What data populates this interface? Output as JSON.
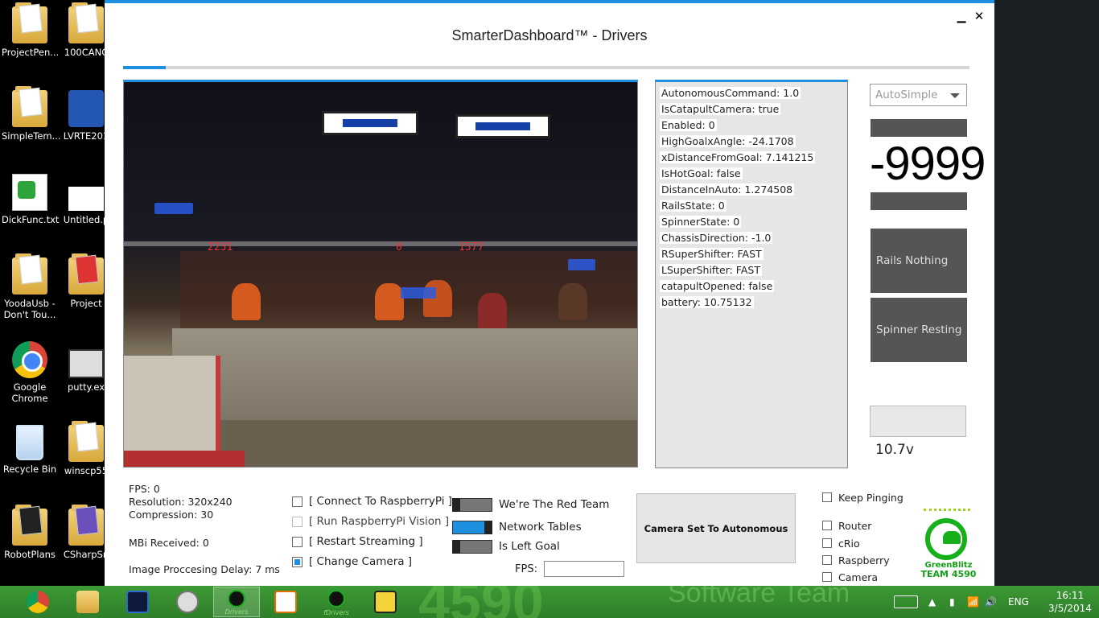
{
  "desktop": {
    "icons": [
      {
        "label": "ProjectPen..."
      },
      {
        "label": "100CANC"
      },
      {
        "label": "SimpleTem..."
      },
      {
        "label": "LVRTE201"
      },
      {
        "label": "DickFunc.txt"
      },
      {
        "label": "Untitled.p"
      },
      {
        "label": "YoodaUsb - Don't Tou..."
      },
      {
        "label": "Project"
      },
      {
        "label": "Google Chrome"
      },
      {
        "label": "putty.ex"
      },
      {
        "label": "Recycle Bin"
      },
      {
        "label": "winscp55"
      },
      {
        "label": "RobotPlans"
      },
      {
        "label": "CSharpSn"
      }
    ]
  },
  "window": {
    "title": "SmarterDashboard™ - Drivers",
    "minimize_glyph": "▁",
    "close_glyph": "✕",
    "progress_fraction": 0.05
  },
  "camera": {
    "scoreboard": [
      "2231",
      "0",
      "1577"
    ]
  },
  "network_values": [
    "AutonomousCommand: 1.0",
    "IsCatapultCamera: true",
    "Enabled: 0",
    "HighGoalxAngle: -24.1708",
    "xDistanceFromGoal: 7.141215",
    "IsHotGoal: false",
    "DistanceInAuto: 1.274508",
    "RailsState: 0",
    "SpinnerState: 0",
    "ChassisDirection: -1.0",
    "RSuperShifter: FAST",
    "LSuperShifter: FAST",
    "catapultOpened: false",
    "battery: 10.75132"
  ],
  "right_panel": {
    "auto_select": "AutoSimple",
    "big_number": "-9999",
    "rails_state": "Rails Nothing",
    "spinner_state": "Spinner Resting",
    "battery_label": "10.7v"
  },
  "stats": {
    "fps": "FPS: 0",
    "resolution": "Resolution: 320x240",
    "compression": "Compression: 30",
    "mbi_received": "MBi Received: 0",
    "processing_delay": "Image Proccesing Delay: 7 ms"
  },
  "checkboxes": [
    {
      "label": "[ Connect To RaspberryPi ]",
      "checked": false,
      "disabled": false
    },
    {
      "label": "[ Run RaspberryPi Vision ]",
      "checked": false,
      "disabled": true
    },
    {
      "label": "[ Restart Streaming ]",
      "checked": false,
      "disabled": false
    },
    {
      "label": "[ Change Camera ]",
      "checked": true,
      "disabled": false
    }
  ],
  "toggles": [
    {
      "label": "We're The Red Team",
      "on": false
    },
    {
      "label": "Network Tables",
      "on": true
    },
    {
      "label": "Is Left Goal",
      "on": false
    }
  ],
  "fps_field": {
    "label": "FPS:",
    "value": ""
  },
  "camera_button": "Camera Set To Autonomous",
  "ping": {
    "keep_pinging": "Keep Pinging",
    "targets": [
      "Router",
      "cRio",
      "Raspberry",
      "Camera"
    ]
  },
  "logo": {
    "line1": "GreenBlitz",
    "line2": "TEAM 4590"
  },
  "taskbar": {
    "watermark": "4590",
    "watermark_sub": "Software Team",
    "apps": [
      {
        "name": "chrome-icon",
        "label": "",
        "active": false
      },
      {
        "name": "file-explorer-icon",
        "label": "",
        "active": false
      },
      {
        "name": "visual-studio-icon",
        "label": "",
        "active": false
      },
      {
        "name": "app-icon",
        "label": "",
        "active": false
      },
      {
        "name": "greenblitz-icon",
        "label": "Drivers",
        "active": true
      },
      {
        "name": "java-icon",
        "label": "",
        "active": false
      },
      {
        "name": "greenblitz-icon",
        "label": "fDrivers",
        "active": false
      },
      {
        "name": "labview-icon",
        "label": "",
        "active": false
      }
    ],
    "language": "ENG",
    "time": "16:11",
    "date": "3/5/2014"
  }
}
